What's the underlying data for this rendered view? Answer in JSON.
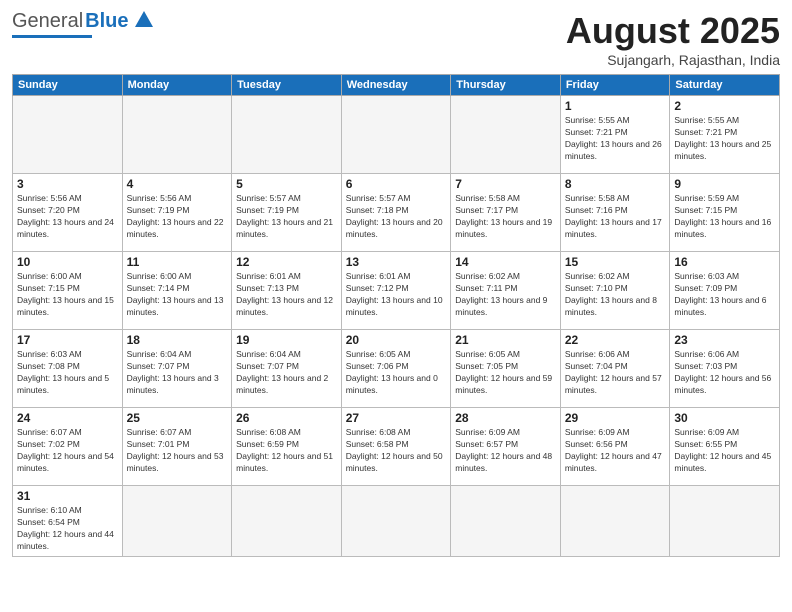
{
  "header": {
    "logo_general": "General",
    "logo_blue": "Blue",
    "month_title": "August 2025",
    "subtitle": "Sujangarh, Rajasthan, India"
  },
  "days_of_week": [
    "Sunday",
    "Monday",
    "Tuesday",
    "Wednesday",
    "Thursday",
    "Friday",
    "Saturday"
  ],
  "weeks": [
    [
      {
        "day": "",
        "info": ""
      },
      {
        "day": "",
        "info": ""
      },
      {
        "day": "",
        "info": ""
      },
      {
        "day": "",
        "info": ""
      },
      {
        "day": "",
        "info": ""
      },
      {
        "day": "1",
        "info": "Sunrise: 5:55 AM\nSunset: 7:21 PM\nDaylight: 13 hours and 26 minutes."
      },
      {
        "day": "2",
        "info": "Sunrise: 5:55 AM\nSunset: 7:21 PM\nDaylight: 13 hours and 25 minutes."
      }
    ],
    [
      {
        "day": "3",
        "info": "Sunrise: 5:56 AM\nSunset: 7:20 PM\nDaylight: 13 hours and 24 minutes."
      },
      {
        "day": "4",
        "info": "Sunrise: 5:56 AM\nSunset: 7:19 PM\nDaylight: 13 hours and 22 minutes."
      },
      {
        "day": "5",
        "info": "Sunrise: 5:57 AM\nSunset: 7:19 PM\nDaylight: 13 hours and 21 minutes."
      },
      {
        "day": "6",
        "info": "Sunrise: 5:57 AM\nSunset: 7:18 PM\nDaylight: 13 hours and 20 minutes."
      },
      {
        "day": "7",
        "info": "Sunrise: 5:58 AM\nSunset: 7:17 PM\nDaylight: 13 hours and 19 minutes."
      },
      {
        "day": "8",
        "info": "Sunrise: 5:58 AM\nSunset: 7:16 PM\nDaylight: 13 hours and 17 minutes."
      },
      {
        "day": "9",
        "info": "Sunrise: 5:59 AM\nSunset: 7:15 PM\nDaylight: 13 hours and 16 minutes."
      }
    ],
    [
      {
        "day": "10",
        "info": "Sunrise: 6:00 AM\nSunset: 7:15 PM\nDaylight: 13 hours and 15 minutes."
      },
      {
        "day": "11",
        "info": "Sunrise: 6:00 AM\nSunset: 7:14 PM\nDaylight: 13 hours and 13 minutes."
      },
      {
        "day": "12",
        "info": "Sunrise: 6:01 AM\nSunset: 7:13 PM\nDaylight: 13 hours and 12 minutes."
      },
      {
        "day": "13",
        "info": "Sunrise: 6:01 AM\nSunset: 7:12 PM\nDaylight: 13 hours and 10 minutes."
      },
      {
        "day": "14",
        "info": "Sunrise: 6:02 AM\nSunset: 7:11 PM\nDaylight: 13 hours and 9 minutes."
      },
      {
        "day": "15",
        "info": "Sunrise: 6:02 AM\nSunset: 7:10 PM\nDaylight: 13 hours and 8 minutes."
      },
      {
        "day": "16",
        "info": "Sunrise: 6:03 AM\nSunset: 7:09 PM\nDaylight: 13 hours and 6 minutes."
      }
    ],
    [
      {
        "day": "17",
        "info": "Sunrise: 6:03 AM\nSunset: 7:08 PM\nDaylight: 13 hours and 5 minutes."
      },
      {
        "day": "18",
        "info": "Sunrise: 6:04 AM\nSunset: 7:07 PM\nDaylight: 13 hours and 3 minutes."
      },
      {
        "day": "19",
        "info": "Sunrise: 6:04 AM\nSunset: 7:07 PM\nDaylight: 13 hours and 2 minutes."
      },
      {
        "day": "20",
        "info": "Sunrise: 6:05 AM\nSunset: 7:06 PM\nDaylight: 13 hours and 0 minutes."
      },
      {
        "day": "21",
        "info": "Sunrise: 6:05 AM\nSunset: 7:05 PM\nDaylight: 12 hours and 59 minutes."
      },
      {
        "day": "22",
        "info": "Sunrise: 6:06 AM\nSunset: 7:04 PM\nDaylight: 12 hours and 57 minutes."
      },
      {
        "day": "23",
        "info": "Sunrise: 6:06 AM\nSunset: 7:03 PM\nDaylight: 12 hours and 56 minutes."
      }
    ],
    [
      {
        "day": "24",
        "info": "Sunrise: 6:07 AM\nSunset: 7:02 PM\nDaylight: 12 hours and 54 minutes."
      },
      {
        "day": "25",
        "info": "Sunrise: 6:07 AM\nSunset: 7:01 PM\nDaylight: 12 hours and 53 minutes."
      },
      {
        "day": "26",
        "info": "Sunrise: 6:08 AM\nSunset: 6:59 PM\nDaylight: 12 hours and 51 minutes."
      },
      {
        "day": "27",
        "info": "Sunrise: 6:08 AM\nSunset: 6:58 PM\nDaylight: 12 hours and 50 minutes."
      },
      {
        "day": "28",
        "info": "Sunrise: 6:09 AM\nSunset: 6:57 PM\nDaylight: 12 hours and 48 minutes."
      },
      {
        "day": "29",
        "info": "Sunrise: 6:09 AM\nSunset: 6:56 PM\nDaylight: 12 hours and 47 minutes."
      },
      {
        "day": "30",
        "info": "Sunrise: 6:09 AM\nSunset: 6:55 PM\nDaylight: 12 hours and 45 minutes."
      }
    ],
    [
      {
        "day": "31",
        "info": "Sunrise: 6:10 AM\nSunset: 6:54 PM\nDaylight: 12 hours and 44 minutes."
      },
      {
        "day": "",
        "info": ""
      },
      {
        "day": "",
        "info": ""
      },
      {
        "day": "",
        "info": ""
      },
      {
        "day": "",
        "info": ""
      },
      {
        "day": "",
        "info": ""
      },
      {
        "day": "",
        "info": ""
      }
    ]
  ]
}
